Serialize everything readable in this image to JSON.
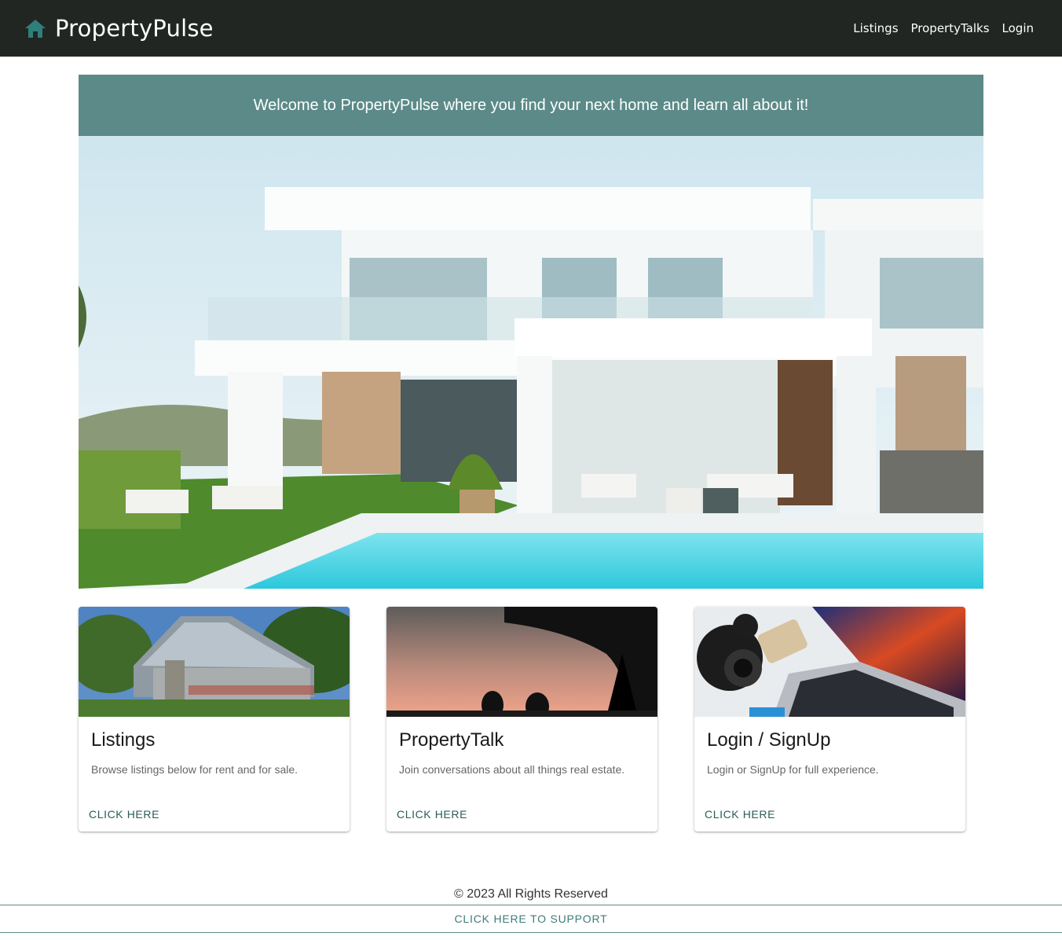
{
  "navbar": {
    "brand_icon": "home-icon",
    "brand_title": "PropertyPulse",
    "links": [
      "Listings",
      "PropertyTalks",
      "Login"
    ]
  },
  "banner": {
    "text": "Welcome to PropertyPulse where you find your next home and learn all about it!"
  },
  "hero": {
    "image": "modern-white-villa-with-pool"
  },
  "cards": [
    {
      "image": "suburban-house",
      "title": "Listings",
      "description": "Browse listings below for rent and for sale.",
      "action": "CLICK HERE"
    },
    {
      "image": "sunset-silhouettes-under-tree",
      "title": "PropertyTalk",
      "description": "Join conversations about all things real estate.",
      "action": "CLICK HERE"
    },
    {
      "image": "camera-and-laptop-desk",
      "title": "Login / SignUp",
      "description": "Login or SignUp for full experience.",
      "action": "CLICK HERE"
    }
  ],
  "footer": {
    "copyright": "© 2023 All Rights Reserved",
    "support": "CLICK HERE TO SUPPORT"
  },
  "colors": {
    "navbar_bg": "#212622",
    "accent_teal": "#5b8a88",
    "icon_teal": "#2f7f7b",
    "link_teal": "#2b5c5a"
  }
}
